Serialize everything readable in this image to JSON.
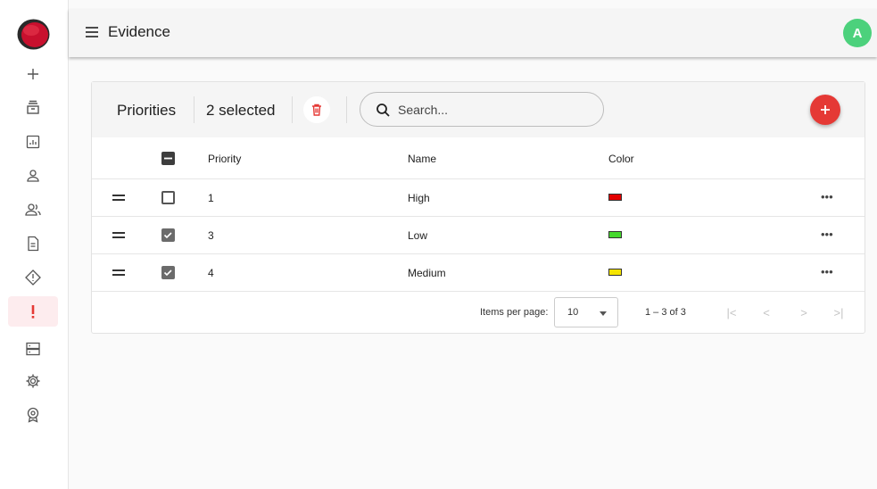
{
  "app": {
    "title": "Evidence",
    "avatar_initial": "A",
    "avatar_color": "#4cd17c",
    "brand_color": "#c8102e"
  },
  "rail": {
    "items": [
      {
        "name": "add-icon"
      },
      {
        "name": "archive-icon"
      },
      {
        "name": "report-icon"
      },
      {
        "name": "user-icon"
      },
      {
        "name": "users-icon"
      },
      {
        "name": "document-icon"
      },
      {
        "name": "diamond-icon"
      },
      {
        "name": "priority-icon",
        "active": true
      },
      {
        "name": "server-icon"
      },
      {
        "name": "settings-icon"
      },
      {
        "name": "badge-icon"
      }
    ]
  },
  "toolbar": {
    "title": "Priorities",
    "selected": "2 selected",
    "search_placeholder": "Search..."
  },
  "table": {
    "headers": [
      "Priority",
      "Name",
      "Color"
    ],
    "rows": [
      {
        "priority": "1",
        "name": "High",
        "color": "#e30000",
        "checked": false
      },
      {
        "priority": "3",
        "name": "Low",
        "color": "#46d92e",
        "checked": true
      },
      {
        "priority": "4",
        "name": "Medium",
        "color": "#f5e400",
        "checked": true
      }
    ]
  },
  "paginator": {
    "items_per_page_label": "Items per page:",
    "page_size": "10",
    "range": "1 – 3 of 3"
  }
}
